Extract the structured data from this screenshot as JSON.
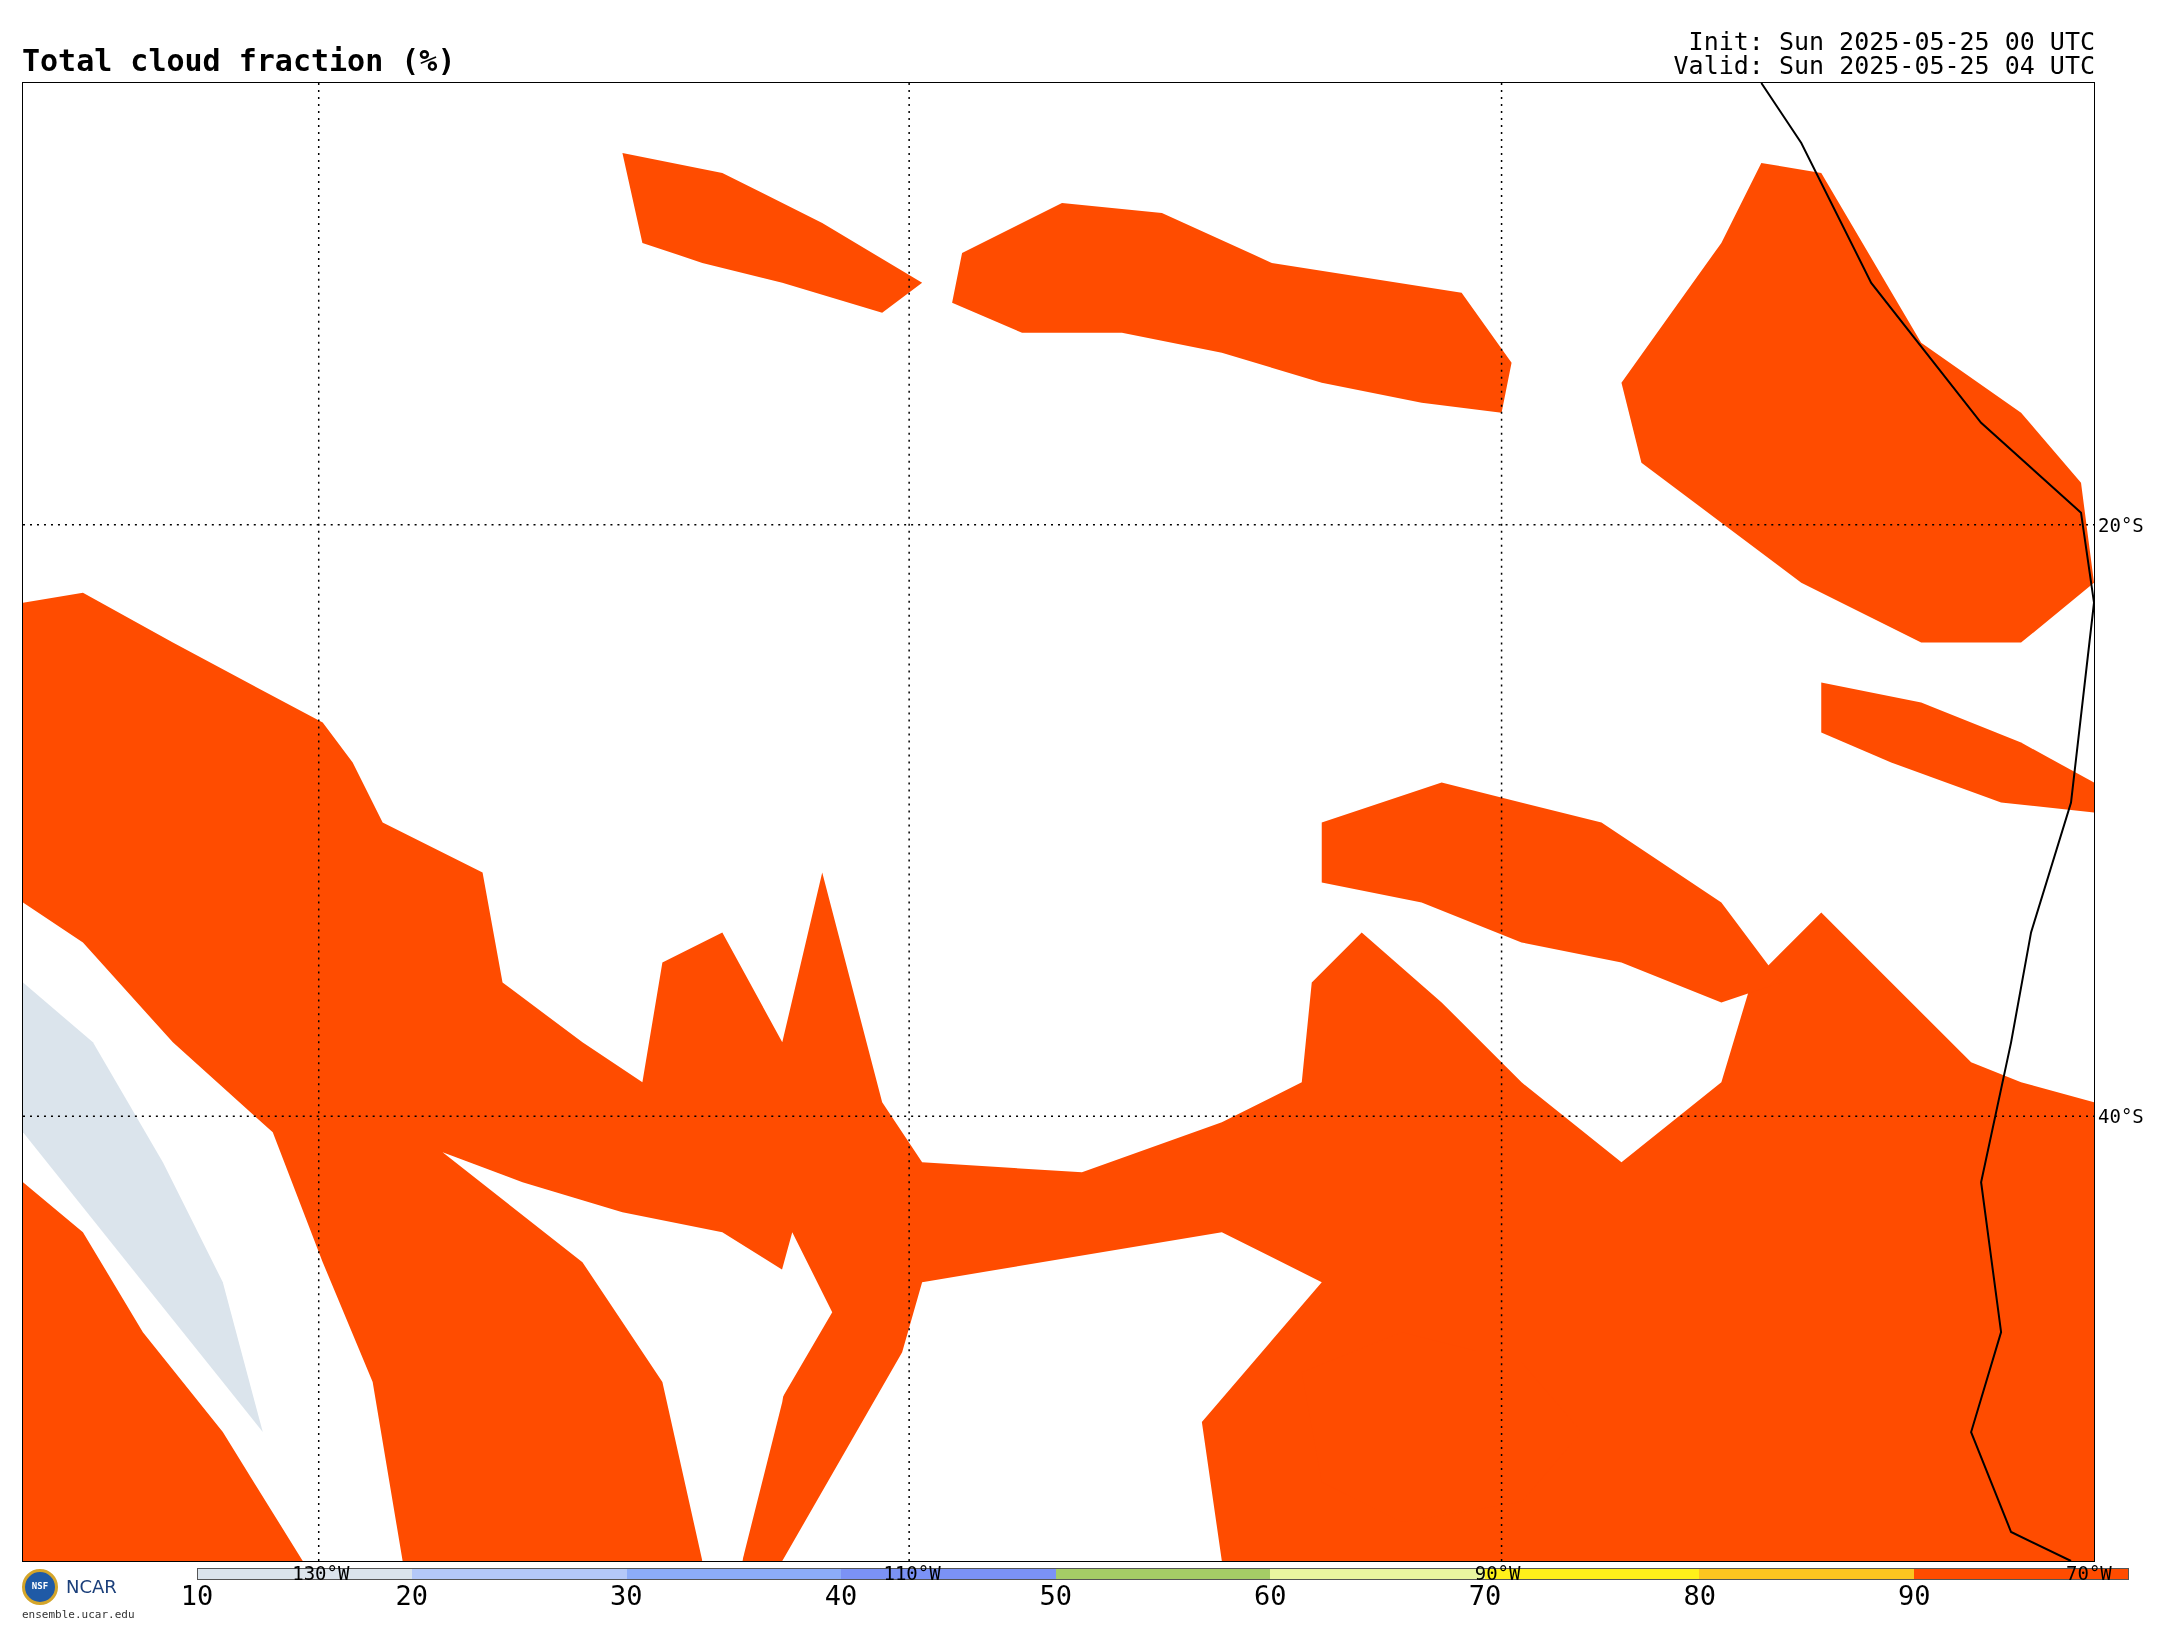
{
  "title": "Total cloud fraction (%)",
  "init": "Init: Sun 2025-05-25 00 UTC",
  "valid": "Valid: Sun 2025-05-25 04 UTC",
  "map": {
    "lon_labels": [
      "130°W",
      "110°W",
      "90°W",
      "70°W"
    ],
    "lat_labels": [
      "20°S",
      "40°S"
    ]
  },
  "logos": {
    "nsf": "NSF",
    "ncar": "NCAR",
    "url": "ensemble.ucar.edu"
  },
  "colorbar": {
    "labels": [
      "10",
      "20",
      "30",
      "40",
      "50",
      "60",
      "70",
      "80",
      "90"
    ],
    "bins": [
      {
        "color": "#dbe4ec"
      },
      {
        "color": "#b4c8f8"
      },
      {
        "color": "#8cacf8"
      },
      {
        "color": "#7b92f5"
      },
      {
        "color": "#a5cc66"
      },
      {
        "color": "#eaf5a0"
      },
      {
        "color": "#fff01a"
      },
      {
        "color": "#fcc520"
      },
      {
        "color": "#ff4c00"
      }
    ]
  }
}
